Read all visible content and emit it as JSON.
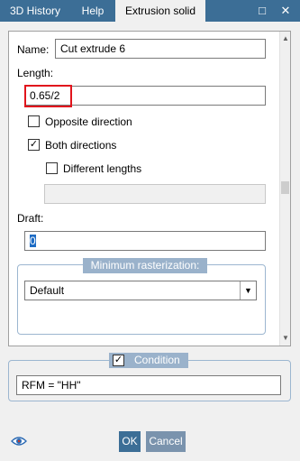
{
  "tabs": [
    {
      "label": "3D History"
    },
    {
      "label": "Help"
    },
    {
      "label": "Extrusion solid"
    }
  ],
  "window_buttons": {
    "restore": "□",
    "close": "✕"
  },
  "form": {
    "name_label": "Name:",
    "name_value": "Cut extrude 6",
    "length_label": "Length:",
    "length_value": "0.65/2",
    "opposite_direction_label": "Opposite direction",
    "opposite_direction_checked": false,
    "both_directions_label": "Both directions",
    "both_directions_checked": true,
    "both_directions_mark": "✓",
    "different_lengths_label": "Different lengths",
    "different_lengths_checked": false,
    "second_length_value": "",
    "draft_label": "Draft:",
    "draft_value": "0"
  },
  "rasterization": {
    "title": "Minimum rasterization:",
    "selected": "Default",
    "arrow": "▼"
  },
  "scrollbar": {
    "up": "▲",
    "down": "▼"
  },
  "condition": {
    "title": "Condition",
    "checked": true,
    "mark": "✓",
    "value": "RFM = \"HH\""
  },
  "footer": {
    "ok_label": "OK",
    "cancel_label": "Cancel",
    "eye_icon": "eye-icon"
  },
  "colors": {
    "accent": "#3c6e96",
    "group_title": "#9ab2cb",
    "highlight": "#e1141c",
    "selection": "#1e6cc4"
  }
}
